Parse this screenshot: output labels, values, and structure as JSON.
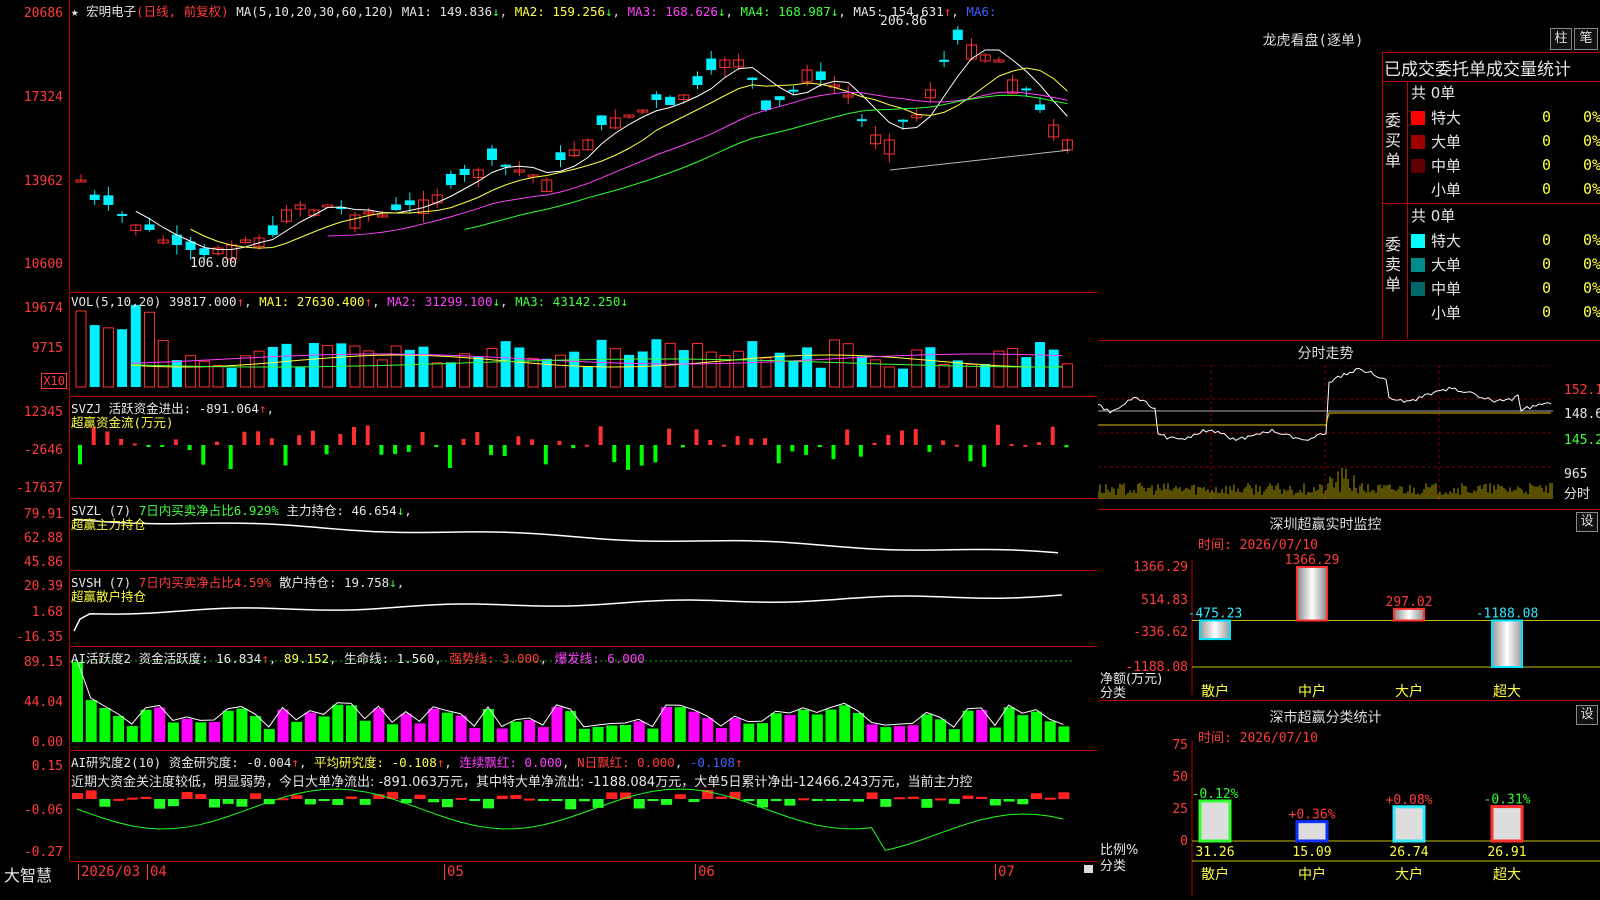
{
  "stock": {
    "name": "宏明电子",
    "mode": "(日线, 前复权)",
    "ma_label": "MA(5,10,20,30,60,120)",
    "ma1": "MA1: 149.836",
    "ma2": "MA2: 159.256",
    "ma3": "MA3: 168.626",
    "ma4": "MA4: 168.987",
    "ma5": "MA5: 154.631",
    "ma6": "MA6:",
    "high_mark": "206.86",
    "low_mark": "106.00",
    "price_axis": [
      "20686",
      "17324",
      "13962",
      "10600"
    ]
  },
  "volume": {
    "label": "VOL(5,10,20)",
    "value": "39817.000",
    "ma1": "MA1: 27630.400",
    "ma2": "MA2: 31299.100",
    "ma3": "MA3: 43142.250",
    "axis": [
      "19674",
      "9715"
    ],
    "unit": "X10"
  },
  "svzj": {
    "label": "SVZJ",
    "text": "活跃资金进出: -891.064",
    "sub": "超赢资金流(万元)",
    "axis": [
      "12345",
      "-2646",
      "-17637"
    ]
  },
  "svzl": {
    "label": "SVZL (7)",
    "text1": "7日内买卖净占比6.929%",
    "text2": "主力持仓: 46.654",
    "sub": "超赢主力持仓",
    "axis": [
      "79.91",
      "62.88",
      "45.86"
    ]
  },
  "svsh": {
    "label": "SVSH (7)",
    "text1": "7日内买卖净占比4.59%",
    "text2": "散户持仓: 19.758",
    "sub": "超赢散户持仓",
    "axis": [
      "20.39",
      "1.68",
      "-16.35"
    ]
  },
  "ai1": {
    "label": "AI活跃度2",
    "v1": "资金活跃度: 16.834",
    "v2": "89.152",
    "v3": "生命线: 1.560",
    "v4": "强势线: 3.000",
    "v5": "爆发线: 6.000",
    "axis": [
      "89.15",
      "44.04",
      "0.00"
    ]
  },
  "ai2": {
    "label": "AI研究度2(10)",
    "v1": "资金研究度: -0.004",
    "v2": "平均研究度: -0.108",
    "v3": "连续飘红: 0.000",
    "v4": "N日飘红: 0.000",
    "v5": "-0.108",
    "comment": "近期大资金关注度较低，明显弱势，今日大单净流出: -891.063万元，其中特大单净流出: -1188.084万元，大单5日累计净出-12466.243万元，当前主力控",
    "axis": [
      "0.15",
      "-0.06",
      "-0.27"
    ]
  },
  "dates": {
    "brand": "大智慧",
    "labels": [
      "2026/03",
      "04",
      "05",
      "06",
      "07"
    ]
  },
  "dragon": {
    "title": "龙虎看盘(逐单)",
    "btn1": "柱",
    "btn2": "笔",
    "header": "已成交委托单成交量统计",
    "buy_label": "委买单",
    "sell_label": "委卖单",
    "buy_total": "共 0单",
    "sell_total": "共 0单",
    "buy_rows": [
      {
        "name": "特大",
        "n": "0",
        "pct": "0%",
        "color": "#ff0000"
      },
      {
        "name": "大单",
        "n": "0",
        "pct": "0%",
        "color": "#a00000"
      },
      {
        "name": "中单",
        "n": "0",
        "pct": "0%",
        "color": "#600000"
      },
      {
        "name": "小单",
        "n": "0",
        "pct": "0%",
        "color": "#000000"
      }
    ],
    "sell_rows": [
      {
        "name": "特大",
        "n": "0",
        "pct": "0%",
        "color": "#00ffff"
      },
      {
        "name": "大单",
        "n": "0",
        "pct": "0%",
        "color": "#008c8c"
      },
      {
        "name": "中单",
        "n": "0",
        "pct": "0%",
        "color": "#006868"
      },
      {
        "name": "小单",
        "n": "0",
        "pct": "0%",
        "color": "#000000"
      }
    ]
  },
  "intraday": {
    "title": "分时走势",
    "axis": [
      "152.1",
      "148.6",
      "145.2",
      "965",
      "分时"
    ]
  },
  "monitor": {
    "title": "深圳超赢实时监控",
    "btn": "设",
    "time": "时间: 2026/07/10",
    "axis": [
      "1366.29",
      "514.83",
      "-336.62",
      "-1188.08"
    ],
    "ylabel": "净额(万元)",
    "xlabel": "分类",
    "cats": [
      "散户",
      "中户",
      "大户",
      "超大"
    ],
    "values": [
      -475.23,
      1366.29,
      297.02,
      -1188.08
    ],
    "value_labels": [
      "-475.23",
      "1366.29",
      "297.02",
      "-1188.08"
    ]
  },
  "classify": {
    "title": "深市超赢分类统计",
    "btn": "设",
    "time": "时间: 2026/07/10",
    "axis": [
      "75",
      "50",
      "25",
      "0"
    ],
    "ylabel": "比例%",
    "xlabel": "分类",
    "cats": [
      "散户",
      "中户",
      "大户",
      "超大"
    ],
    "values": [
      31.26,
      15.09,
      26.74,
      26.91
    ],
    "value_labels": [
      "31.26",
      "15.09",
      "26.74",
      "26.91"
    ],
    "changes": [
      "-0.12%",
      "+0.36%",
      "+0.08%",
      "-0.31%"
    ]
  },
  "colors": {
    "up": "#ff3030",
    "down": "#00f0ff",
    "frame": "#c00000",
    "green": "#00ff00",
    "magenta": "#ff00ff"
  }
}
